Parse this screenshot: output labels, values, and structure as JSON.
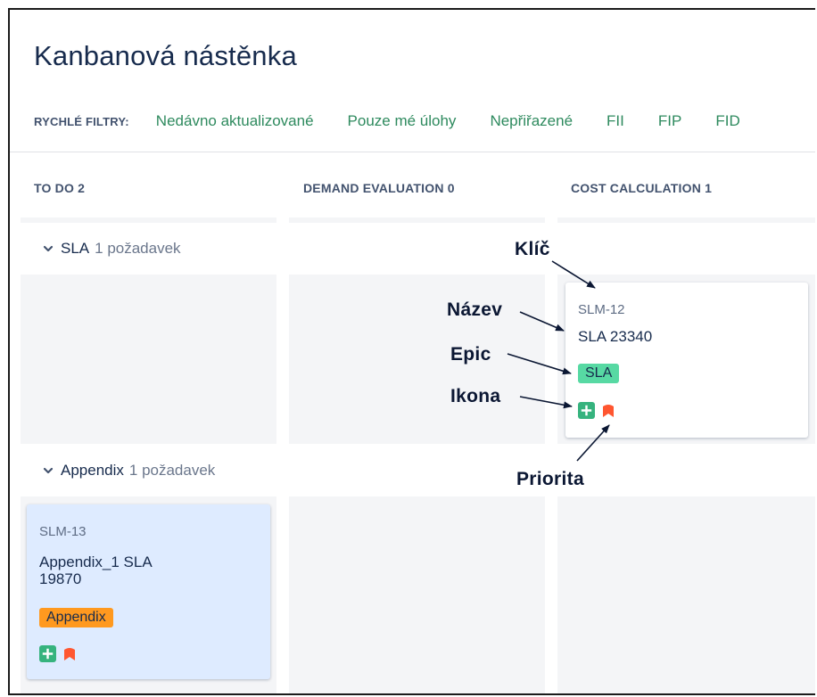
{
  "board": {
    "title": "Kanbanová nástěnka"
  },
  "filters": {
    "label": "RYCHLÉ FILTRY:",
    "items": [
      "Nedávno aktualizované",
      "Pouze mé úlohy",
      "Nepřiřazené",
      "FII",
      "FIP",
      "FID"
    ]
  },
  "columns": [
    {
      "name": "TO DO",
      "count": "2"
    },
    {
      "name": "DEMAND EVALUATION",
      "count": "0"
    },
    {
      "name": "COST CALCULATION",
      "count": "1"
    }
  ],
  "swimlanes": [
    {
      "name": "SLA",
      "count": "1 požadavek"
    },
    {
      "name": "Appendix",
      "count": "1 požadavek"
    }
  ],
  "cards": [
    {
      "key": "SLM-12",
      "summary": "SLA 23340",
      "epic": "SLA",
      "epic_color": "#57d9a3"
    },
    {
      "key": "SLM-13",
      "summary_line1": "Appendix_1 SLA",
      "summary_line2": "19870",
      "epic": "Appendix",
      "epic_color": "#ff991f"
    }
  ],
  "annotations": {
    "key": "Klíč",
    "name": "Název",
    "epic": "Epic",
    "icon": "Ikona",
    "priority": "Priorita"
  },
  "colors": {
    "filter_link": "#2e8a5e",
    "column_bg": "#f4f5f7",
    "selected_card": "#deebff",
    "issue_type_green": "#36b37e",
    "priority_red": "#ff5630"
  },
  "icons": {
    "issue_type": "plus-square-icon",
    "priority": "priority-bookmark-icon",
    "collapse": "chevron-down-icon"
  }
}
